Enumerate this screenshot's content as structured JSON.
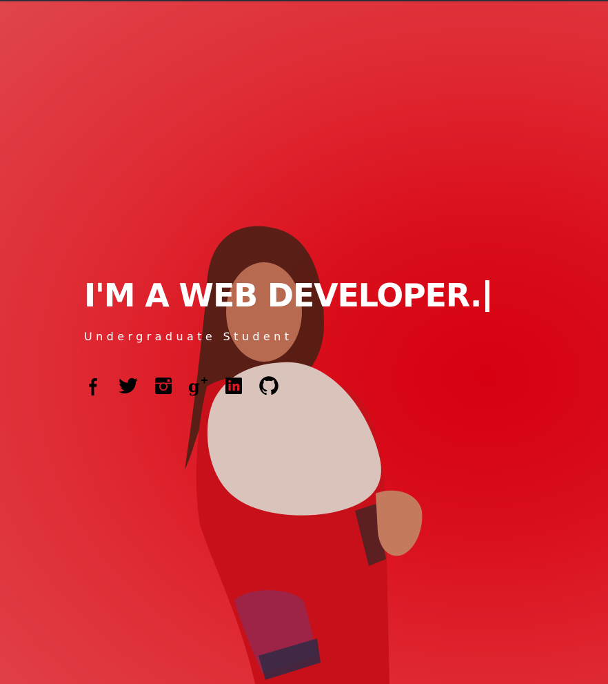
{
  "hero": {
    "headline": "I'M A WEB DEVELOPER.",
    "subtitle": "Undergraduate Student"
  },
  "social": [
    {
      "icon": "facebook-icon"
    },
    {
      "icon": "twitter-icon"
    },
    {
      "icon": "instagram-icon"
    },
    {
      "icon": "google-plus-icon"
    },
    {
      "icon": "linkedin-icon"
    },
    {
      "icon": "github-icon"
    }
  ],
  "colors": {
    "background": "#df1a24",
    "headline": "#ffffff",
    "icons": "#000000"
  }
}
